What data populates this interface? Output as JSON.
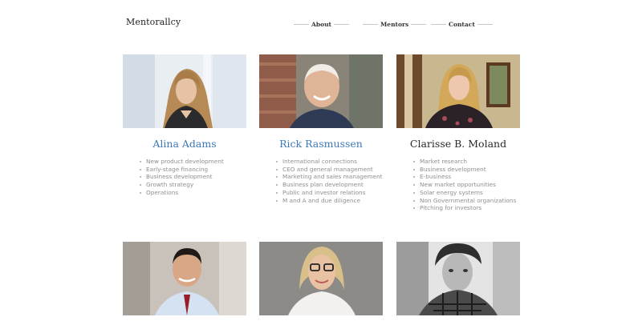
{
  "header": {
    "logo": "Mentorallcy",
    "nav": [
      {
        "label": "About"
      },
      {
        "label": "Mentors"
      },
      {
        "label": "Contact"
      }
    ]
  },
  "mentors": [
    {
      "name": "Alina Adams",
      "skills": [
        "New product development",
        "Early-stage financing",
        "Business development",
        "Growth strategy",
        "Operations"
      ]
    },
    {
      "name": "Rick Rasmussen",
      "skills": [
        "International connections",
        "CEO and general management",
        "Marketing and sales management",
        "Business plan development",
        "Public and investor relations",
        "M and A and due diligence"
      ]
    },
    {
      "name": "Clarisse B. Moland",
      "skills": [
        "Market research",
        "Business development",
        "E-business",
        "New market opportunities",
        "Solar energy systems",
        "Non Governmental organizations",
        "Pitching for investors"
      ]
    }
  ]
}
